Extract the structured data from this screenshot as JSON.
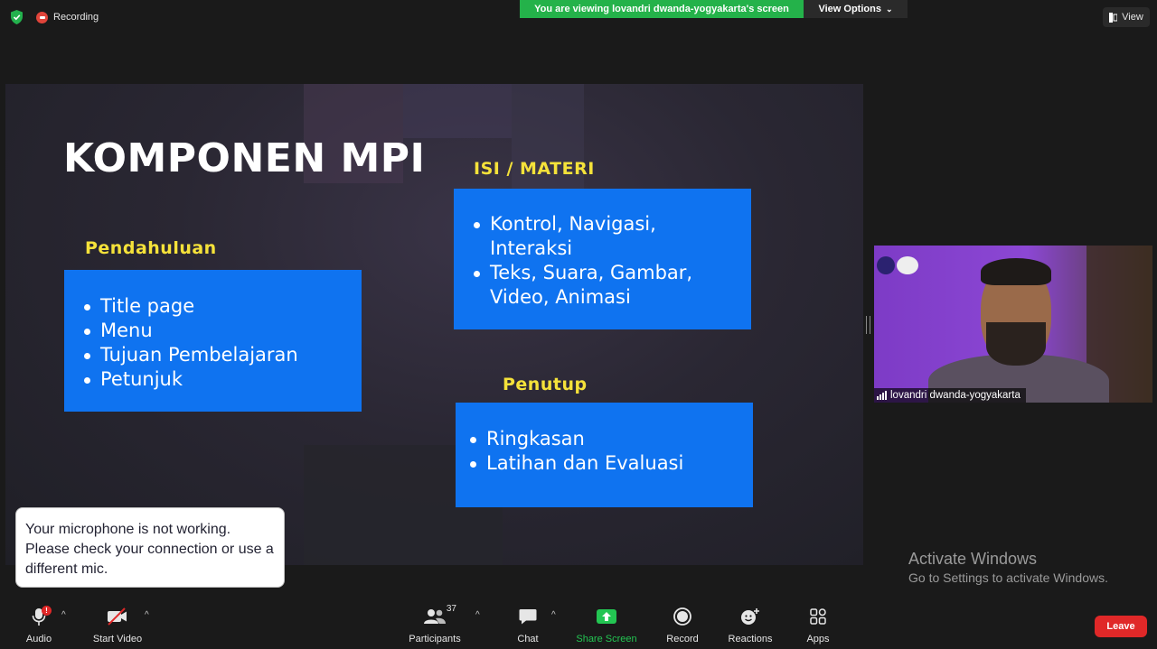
{
  "top": {
    "recording_label": "Recording",
    "viewing_banner": "You are viewing lovandri dwanda-yogyakarta's screen",
    "view_options_label": "View Options",
    "view_label": "View"
  },
  "slide": {
    "title": "KOMPONEN MPI",
    "sections": {
      "pendahuluan": {
        "heading": "Pendahuluan",
        "items": [
          "Title page",
          "Menu",
          "Tujuan Pembelajaran",
          "Petunjuk"
        ]
      },
      "isi": {
        "heading": "ISI / MATERI",
        "items": [
          "Kontrol, Navigasi, Interaksi",
          "Teks, Suara, Gambar, Video, Animasi"
        ]
      },
      "penutup": {
        "heading": "Penutup",
        "items": [
          "Ringkasan",
          "Latihan dan Evaluasi"
        ]
      }
    }
  },
  "toast": {
    "message": "Your microphone is not working. Please check your connection or use a different mic."
  },
  "video": {
    "participant_name": "lovandri dwanda-yogyakarta"
  },
  "watermark": {
    "title": "Activate Windows",
    "subtitle": "Go to Settings to activate Windows."
  },
  "toolbar": {
    "audio": "Audio",
    "audio_badge": "!",
    "start_video": "Start Video",
    "participants": "Participants",
    "participant_count": "37",
    "chat": "Chat",
    "share_screen": "Share Screen",
    "record": "Record",
    "reactions": "Reactions",
    "apps": "Apps",
    "leave": "Leave"
  },
  "colors": {
    "banner_green": "#24b24a",
    "slide_box_blue": "#0f73f0",
    "slide_heading_yellow": "#f5e23a",
    "leave_red": "#e02828"
  }
}
